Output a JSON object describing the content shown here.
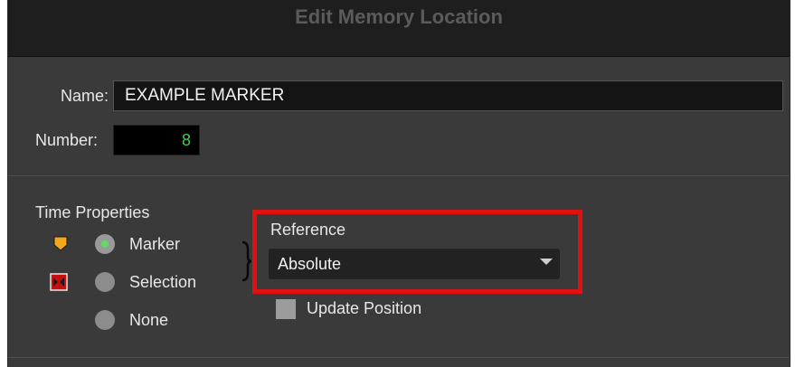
{
  "dialog": {
    "title": "Edit Memory Location",
    "name_label": "Name:",
    "name_value": "EXAMPLE MARKER",
    "number_label": "Number:",
    "number_value": "8"
  },
  "time_properties": {
    "heading": "Time Properties",
    "options": [
      {
        "label": "Marker",
        "selected": true,
        "icon": "marker-icon"
      },
      {
        "label": "Selection",
        "selected": false,
        "icon": "selection-icon"
      },
      {
        "label": "None",
        "selected": false,
        "icon": ""
      }
    ]
  },
  "reference": {
    "label": "Reference",
    "selected": "Absolute",
    "update_position_label": "Update Position",
    "update_position_checked": false
  },
  "colors": {
    "highlight": "#e11111",
    "marker_icon": "#f2a81d",
    "selection_icon": "#c61010",
    "number_text": "#40d04a",
    "radio_selected_dot": "#5fdc63"
  }
}
